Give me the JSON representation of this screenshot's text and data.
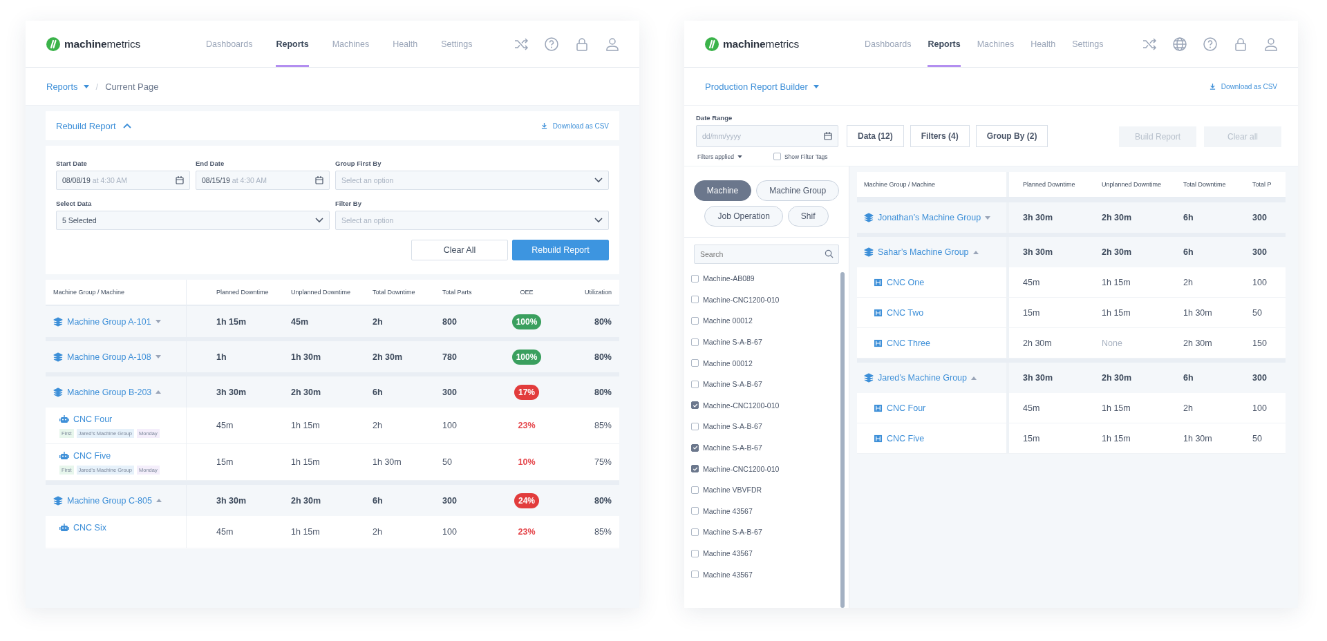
{
  "left_screen": {
    "logo": "**machine**metrics",
    "nav": [
      {
        "label": "Dashboards",
        "selected": false
      },
      {
        "label": "Reports",
        "selected": true
      },
      {
        "label": "Machines",
        "selected": false
      },
      {
        "label": "Health",
        "selected": false
      },
      {
        "label": "Settings",
        "selected": false
      }
    ],
    "toolbar_icons": [
      {
        "kind": "shuffle"
      },
      {
        "kind": "help"
      },
      {
        "kind": "lock"
      },
      {
        "kind": "user"
      }
    ],
    "breadcrumb": {
      "root": "Reports",
      "separator": "/",
      "current": "Current Page"
    },
    "report_bar": {
      "title": "Rebuild Report",
      "expanded": true,
      "download": "Download as CSV"
    },
    "form": {
      "fields": [
        {
          "kind": "date",
          "label": "Start Date",
          "value": "08/08/19",
          "time": "at 4:30 AM"
        },
        {
          "kind": "date",
          "label": "End Date",
          "value": "08/15/19",
          "time": "at 4:30 AM"
        },
        {
          "kind": "select",
          "label": "Group First By",
          "placeholder": "Select an option"
        },
        {
          "kind": "select",
          "label": "Select Data",
          "value": "5 Selected"
        },
        {
          "kind": "select",
          "label": "Filter By",
          "placeholder": "Select an option"
        }
      ],
      "buttons": [
        {
          "label": "Clear All",
          "primary": false
        },
        {
          "label": "Rebuild Report",
          "primary": true
        }
      ]
    },
    "table": {
      "columns": [
        "Machine Group / Machine",
        "Planned Downtime",
        "Unplanned Downtime",
        "Total Downtime",
        "Total Parts",
        "OEE",
        "Utilization"
      ],
      "rows": [
        {
          "kind": "group",
          "expanded": false,
          "cells": [
            "Machine Group A-101",
            "1h 15m",
            "45m",
            "2h",
            "800",
            "100%",
            "80%"
          ],
          "oee_ok": true
        },
        {
          "kind": "group",
          "expanded": false,
          "cells": [
            "Machine Group A-108",
            "1h",
            "1h 30m",
            "2h 30m",
            "780",
            "100%",
            "80%"
          ],
          "oee_ok": true
        },
        {
          "kind": "group",
          "expanded": true,
          "cells": [
            "Machine Group B-203",
            "3h 30m",
            "2h 30m",
            "6h",
            "300",
            "17%",
            "80%"
          ],
          "oee_ok": false
        },
        {
          "kind": "machine",
          "cells": [
            "CNC Four",
            "45m",
            "1h 15m",
            "2h",
            "100",
            "23%",
            "85%"
          ],
          "oee_ok": false,
          "tags": [
            {
              "label": "First",
              "color": "#e7f6ec"
            },
            {
              "label": "Jared’s Machine Group",
              "color": "#e6f1fa"
            },
            {
              "label": "Monday",
              "color": "#f4eefb"
            }
          ]
        },
        {
          "kind": "machine",
          "cells": [
            "CNC Five",
            "15m",
            "1h 15m",
            "1h 30m",
            "50",
            "10%",
            "75%"
          ],
          "oee_ok": false,
          "tags": [
            {
              "label": "First",
              "color": "#e7f6ec"
            },
            {
              "label": "Jared’s Machine Group",
              "color": "#e6f1fa"
            },
            {
              "label": "Monday",
              "color": "#f4eefb"
            }
          ]
        },
        {
          "kind": "group",
          "expanded": true,
          "cells": [
            "Machine Group C-805",
            "3h 30m",
            "2h 30m",
            "6h",
            "300",
            "24%",
            "80%"
          ],
          "oee_ok": false
        },
        {
          "kind": "machine",
          "cells": [
            "CNC Six",
            "45m",
            "1h 15m",
            "2h",
            "100",
            "23%",
            "85%"
          ],
          "oee_ok": false
        }
      ]
    }
  },
  "right_screen": {
    "logo": "**machine**metrics",
    "nav": [
      {
        "label": "Dashboards",
        "selected": false
      },
      {
        "label": "Reports",
        "selected": true
      },
      {
        "label": "Machines",
        "selected": false
      },
      {
        "label": "Health",
        "selected": false
      },
      {
        "label": "Settings",
        "selected": false
      }
    ],
    "toolbar_icons": [
      {
        "kind": "shuffle"
      },
      {
        "kind": "globe"
      },
      {
        "kind": "help"
      },
      {
        "kind": "lock"
      },
      {
        "kind": "user"
      }
    ],
    "title_bar": {
      "title": "Production Report Builder",
      "download": "Download as CSV"
    },
    "controls": {
      "date_range": {
        "label": "Date Range",
        "placeholder": "dd/mm/yyyy"
      },
      "toggles": [
        "Data (12)",
        "Filters (4)",
        "Group By (2)"
      ],
      "actions": [
        {
          "label": "Build Report",
          "disabled": true
        },
        {
          "label": "Clear all",
          "disabled": true
        }
      ],
      "filters_applied": "Filters applied",
      "show_filter_tags": {
        "label": "Show Filter Tags",
        "checked": false
      }
    },
    "chips": [
      {
        "label": "Machine",
        "selected": true
      },
      {
        "label": "Machine Group",
        "selected": false
      },
      {
        "label": "Job Operation",
        "selected": false
      },
      {
        "label": "Shif",
        "selected": false
      }
    ],
    "search": {
      "placeholder": "Search"
    },
    "machine_list": [
      {
        "label": "Machine-AB089",
        "checked": false
      },
      {
        "label": "Machine-CNC1200-010",
        "checked": false
      },
      {
        "label": "Machine 00012",
        "checked": false
      },
      {
        "label": "Machine S-A-B-67",
        "checked": false
      },
      {
        "label": "Machine 00012",
        "checked": false
      },
      {
        "label": "Machine S-A-B-67",
        "checked": false
      },
      {
        "label": "Machine-CNC1200-010",
        "checked": true
      },
      {
        "label": "Machine S-A-B-67",
        "checked": false
      },
      {
        "label": "Machine S-A-B-67",
        "checked": true
      },
      {
        "label": "Machine-CNC1200-010",
        "checked": true
      },
      {
        "label": "Machine VBVFDR",
        "checked": false
      },
      {
        "label": "Machine 43567",
        "checked": false
      },
      {
        "label": "Machine S-A-B-67",
        "checked": false
      },
      {
        "label": "Machine 43567",
        "checked": false
      },
      {
        "label": "Machine 43567",
        "checked": false
      }
    ],
    "table": {
      "columns": [
        "Machine Group / Machine",
        "Planned Downtime",
        "Unplanned Downtime",
        "Total Downtime",
        "Total P"
      ],
      "rows": [
        {
          "kind": "group",
          "expanded": false,
          "cells": [
            "Jonathan’s Machine Group",
            "3h 30m",
            "2h 30m",
            "6h",
            "300"
          ]
        },
        {
          "kind": "group",
          "expanded": true,
          "cells": [
            "Sahar’s Machine Group",
            "3h 30m",
            "2h 30m",
            "6h",
            "300"
          ]
        },
        {
          "kind": "machine",
          "cells": [
            "CNC One",
            "45m",
            "1h 15m",
            "2h",
            "100"
          ]
        },
        {
          "kind": "machine",
          "cells": [
            "CNC Two",
            "15m",
            "1h 15m",
            "1h 30m",
            "50"
          ]
        },
        {
          "kind": "machine",
          "cells": [
            "CNC Three",
            "2h 30m",
            "None",
            "2h 30m",
            "150"
          ],
          "dim": [
            false,
            false,
            true,
            false,
            false
          ]
        },
        {
          "kind": "group",
          "expanded": true,
          "cells": [
            "Jared’s Machine Group",
            "3h 30m",
            "2h 30m",
            "6h",
            "300"
          ]
        },
        {
          "kind": "machine",
          "cells": [
            "CNC Four",
            "45m",
            "1h 15m",
            "2h",
            "100"
          ]
        },
        {
          "kind": "machine",
          "cells": [
            "CNC Five",
            "15m",
            "1h 15m",
            "1h 30m",
            "50"
          ]
        }
      ]
    }
  }
}
